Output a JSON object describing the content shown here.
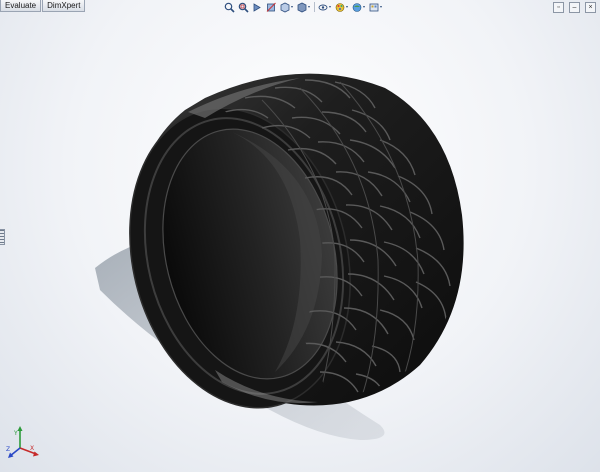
{
  "tabs": [
    "Evaluate",
    "DimXpert"
  ],
  "heads_up_toolbar": {
    "icons": [
      "zoom-to-fit-icon",
      "zoom-to-area-icon",
      "previous-view-icon",
      "section-view-icon",
      "view-orientation-icon",
      "display-style-icon",
      "hide-show-items-icon",
      "edit-appearance-icon",
      "apply-scene-icon",
      "view-settings-icon"
    ]
  },
  "window_controls": [
    "restore-window-icon",
    "minimize-window-icon",
    "close-window-icon"
  ],
  "model": {
    "name": "tire-model",
    "tire_color": "#141414",
    "background_color": "#f1f3f7"
  }
}
